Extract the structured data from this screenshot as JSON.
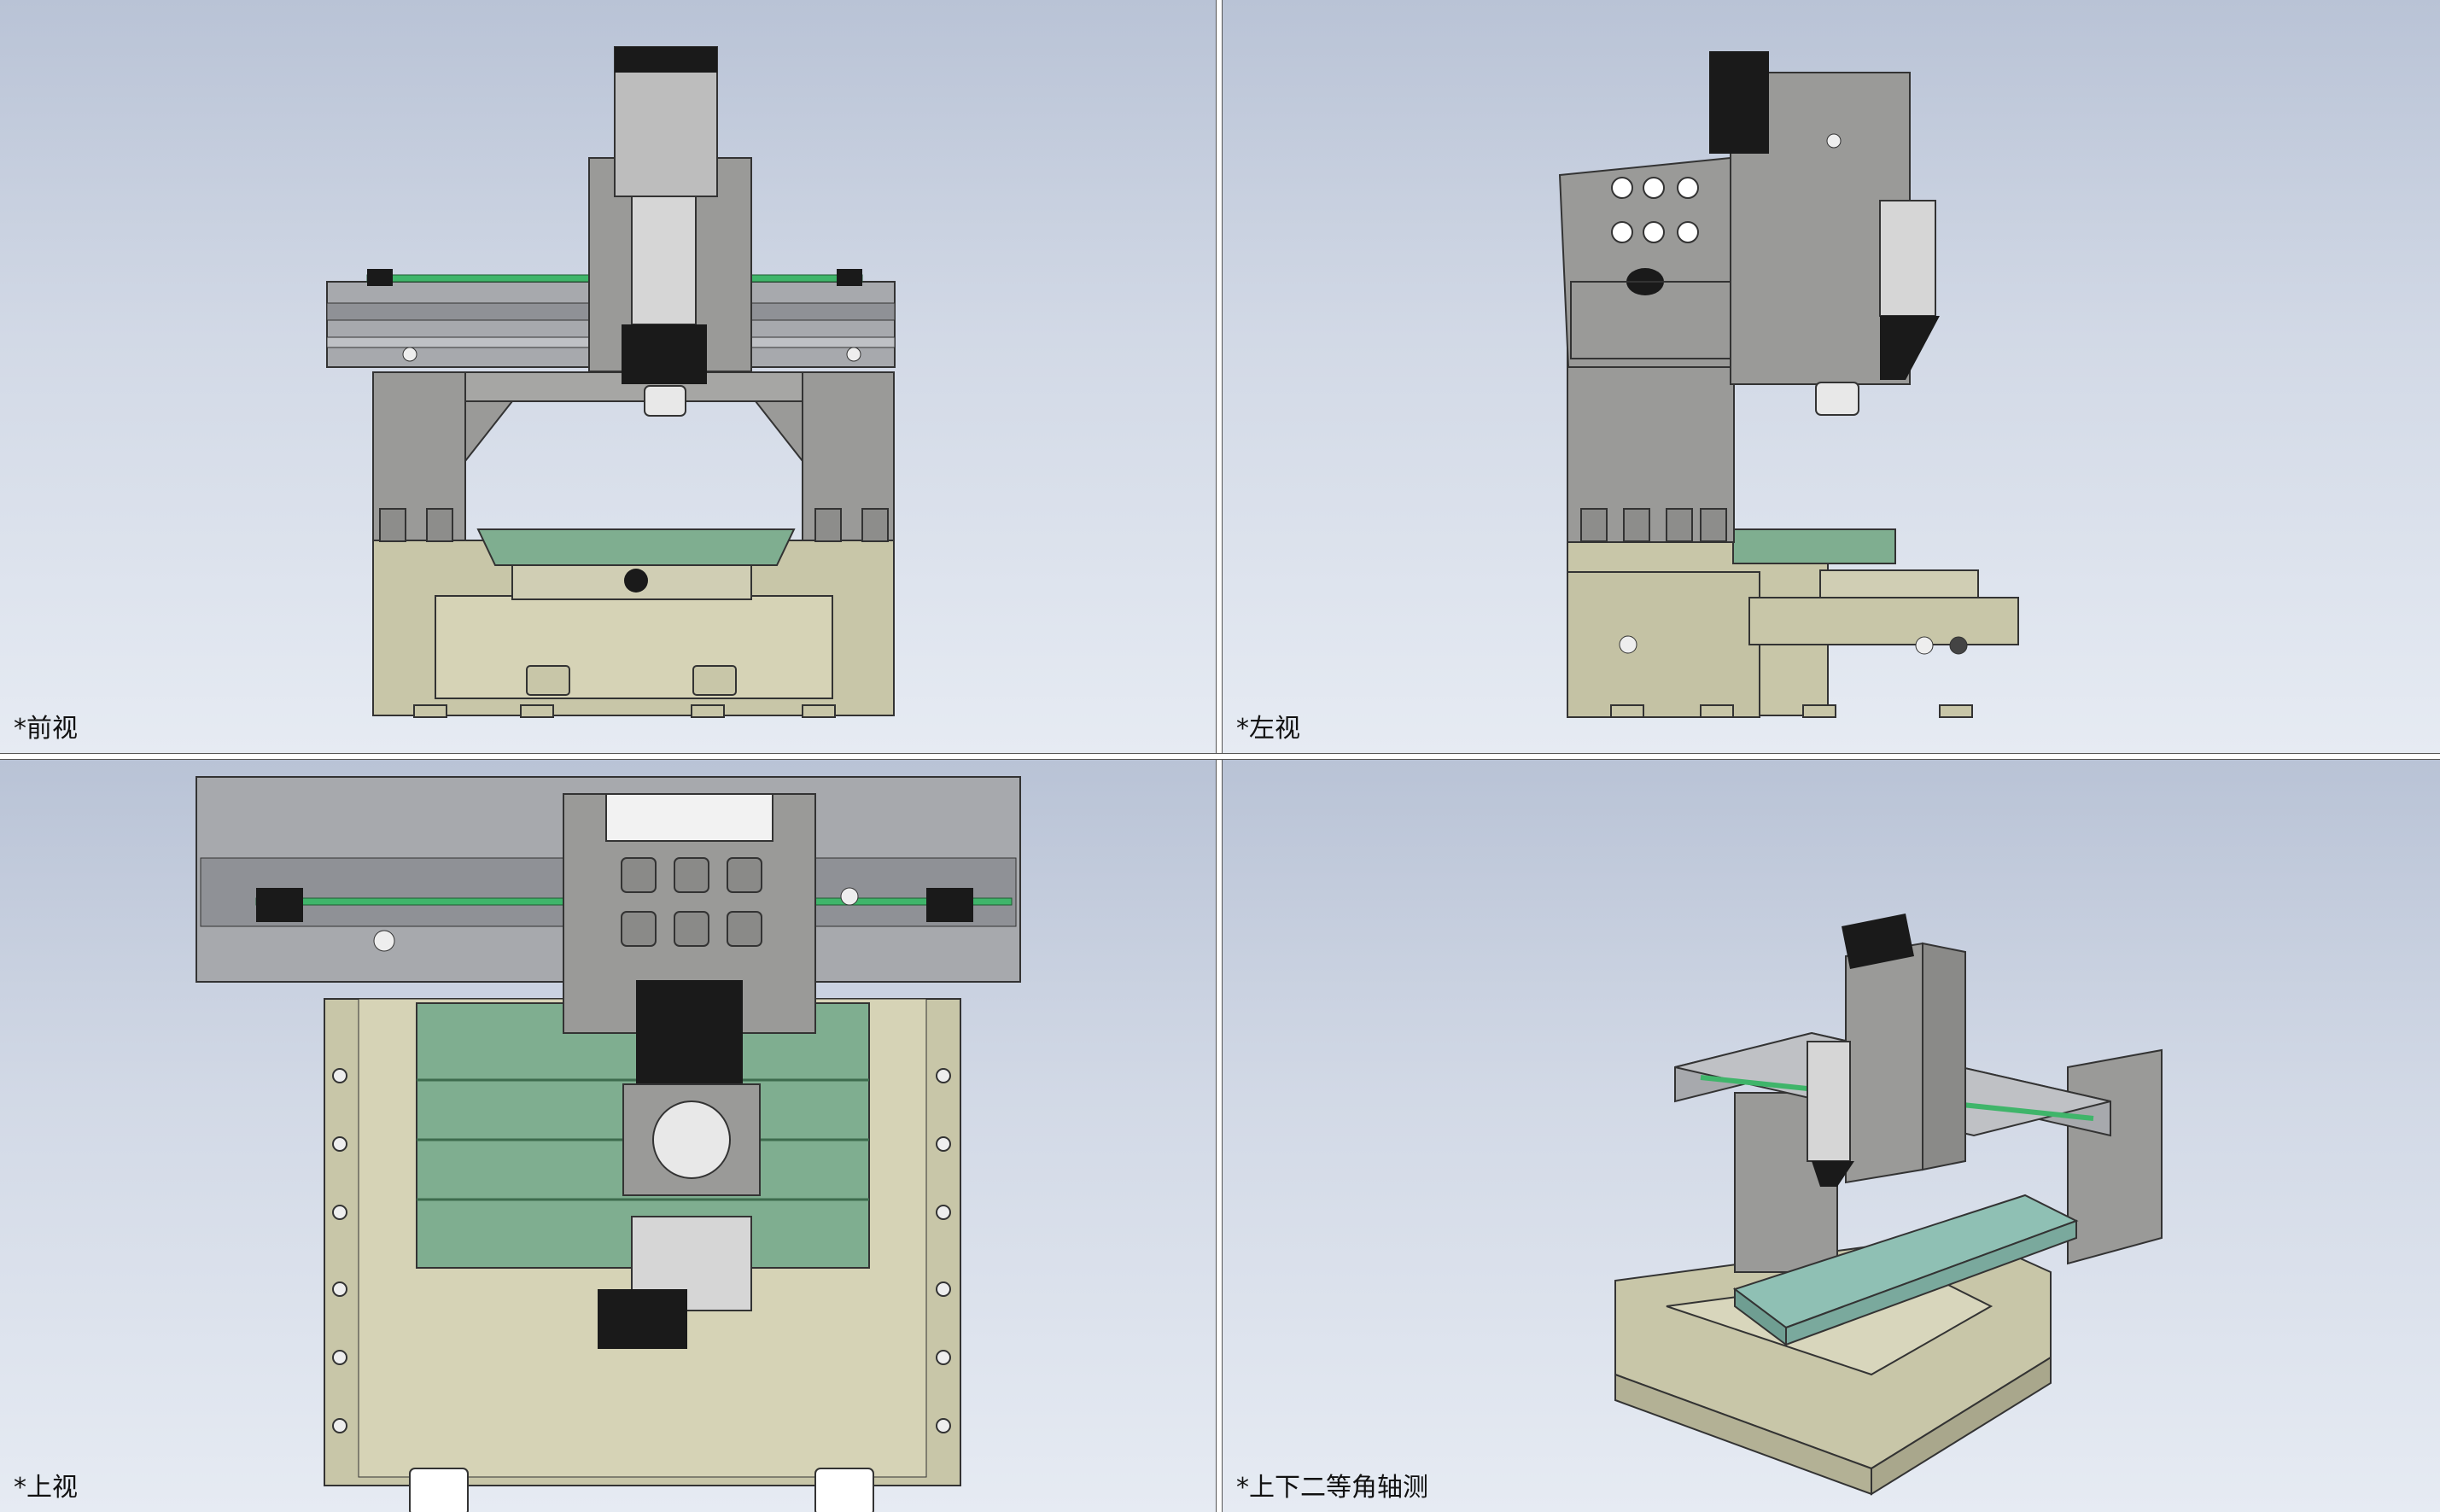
{
  "viewports": {
    "front": {
      "label": "*前视"
    },
    "left": {
      "label": "*左视"
    },
    "top": {
      "label": "*上视"
    },
    "iso": {
      "label": "*上下二等角轴测"
    }
  },
  "colors": {
    "background_top": "#b9c3d6",
    "background_bottom": "#e6ebf3",
    "column_gray": "#9a9a98",
    "base_beige": "#c8c6a8",
    "table_green": "#7fae90",
    "rail_green": "#3fb56a",
    "dark_part": "#1a1a1a",
    "light_part": "#d6d6d6"
  }
}
